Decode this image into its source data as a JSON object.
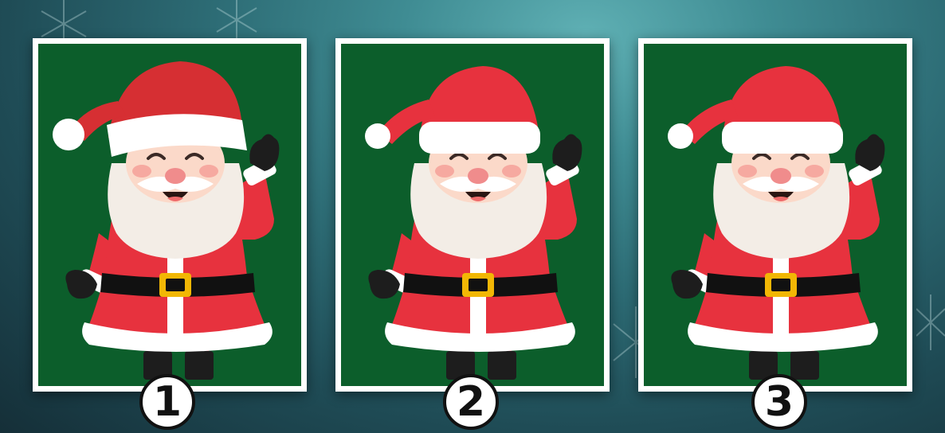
{
  "puzzle": {
    "options": [
      {
        "id": "option-1",
        "number": "1",
        "variant": "tilted-hat"
      },
      {
        "id": "option-2",
        "number": "2",
        "variant": "standard"
      },
      {
        "id": "option-3",
        "number": "3",
        "variant": "standard"
      }
    ]
  },
  "colors": {
    "background": "#2d6c75",
    "card_border": "#ffffff",
    "card_fill": "#0c5e2b",
    "suit_red": "#e7323e",
    "fur_white": "#ffffff",
    "beard": "#f3ede6",
    "skin": "#fbd9c9",
    "belt": "#111111",
    "buckle": "#f2b705",
    "badge_fill": "#ffffff",
    "badge_stroke": "#111111"
  },
  "icons": {
    "decoration": "snowflake-icon",
    "figure": "santa-claus-icon"
  }
}
